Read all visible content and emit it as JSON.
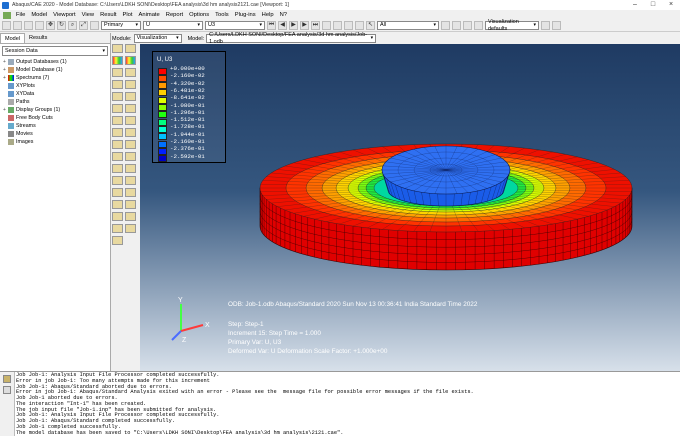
{
  "window": {
    "title": "Abaqus/CAE 2020 - Model Database: C:\\Users\\LDKH SONI\\Desktop\\FEA analysis\\3d hm analysis2121.cae [Viewport: 1]"
  },
  "menu": [
    "File",
    "Model",
    "Viewport",
    "View",
    "Result",
    "Plot",
    "Animate",
    "Report",
    "Options",
    "Tools",
    "Plug-ins",
    "Help",
    "N?"
  ],
  "toolbar": {
    "primary": "Primary",
    "var": "U",
    "comp": "U3",
    "all": "All",
    "vis_defaults": "Visualization defaults"
  },
  "context": {
    "module_label": "Module:",
    "module_value": "Visualization",
    "model_label": "Model:",
    "model_value": "C:/Users/LDKH SONI/Desktop/FEA analysis/3d hm analysis/Job-1.odb"
  },
  "left_panel": {
    "tabs": [
      "Model",
      "Results"
    ],
    "session_combo": "Session Data",
    "tree": [
      "Output Databases (1)",
      "Model Database (1)",
      "Spectrums (7)",
      "XYPlots",
      "XYData",
      "Paths",
      "Display Groups (1)",
      "Free Body Cuts",
      "Streams",
      "Movies",
      "Images"
    ]
  },
  "legend": {
    "title": "U, U3",
    "values": [
      "+0.000e+00",
      "-2.160e-02",
      "-4.320e-02",
      "-6.481e-02",
      "-8.641e-02",
      "-1.080e-01",
      "-1.296e-01",
      "-1.512e-01",
      "-1.728e-01",
      "-1.944e-01",
      "-2.160e-01",
      "-2.376e-01",
      "-2.592e-01"
    ],
    "colors": [
      "#ff0000",
      "#ff4c00",
      "#ff9900",
      "#ffd000",
      "#e3ff00",
      "#8cff00",
      "#20ff10",
      "#00ff80",
      "#00ffd0",
      "#00c0ff",
      "#0070ff",
      "#0020ff",
      "#0000c8"
    ]
  },
  "triad": {
    "x": "X",
    "y": "Y",
    "z": "Z"
  },
  "info": {
    "odb": "ODB: Job-1.odb    Abaqus/Standard 2020    Sun Nov 13 00:36:41 India Standard Time 2022",
    "step": "Step: Step-1",
    "increment": "Increment    15: Step Time =    1.000",
    "primary": "Primary Var: U, U3",
    "deformed": "Deformed Var: U   Deformation Scale Factor: +1.000e+00"
  },
  "console": [
    "Job Job-1: Analysis Input File Processor completed successfully.",
    "Error in job Job-1: Too many attempts made for this increment",
    "Job Job-1: Abaqus/Standard aborted due to errors.",
    "Error in job Job-1: Abaqus/Standard Analysis exited with an error - Please see the  message file for possible error messages if the file exists.",
    "Job Job-1 aborted due to errors.",
    "The interaction \"Int-1\" has been created.",
    "The job input file \"Job-1.inp\" has been submitted for analysis.",
    "Job Job-1: Analysis Input File Processor completed successfully.",
    "Job Job-1: Abaqus/Standard completed successfully.",
    "Job Job-1 completed successfully.",
    "The model database has been saved to \"C:\\Users\\LDKH SONI\\Desktop\\FEA analysis\\3d hm analysis\\2121.cae\"."
  ]
}
